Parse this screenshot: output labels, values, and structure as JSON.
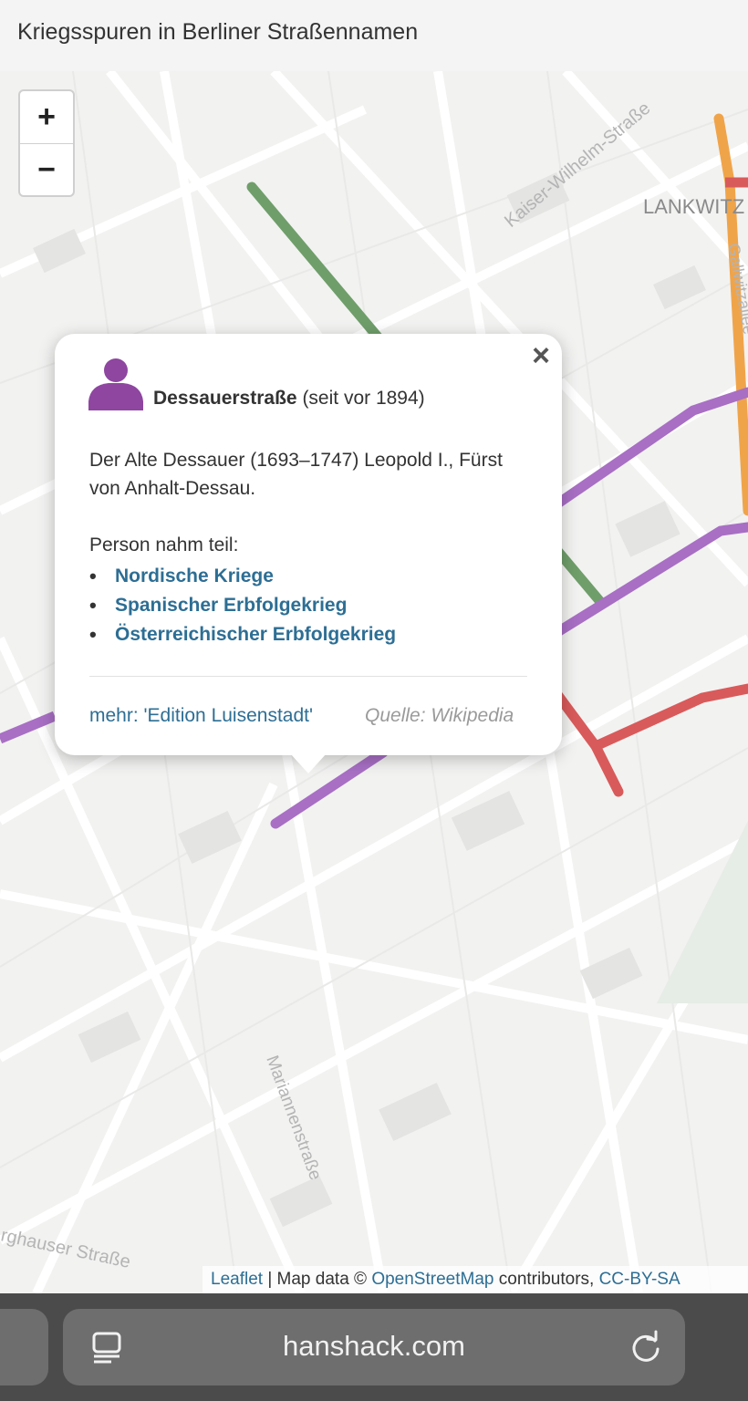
{
  "title": "Kriegsspuren in Berliner Straßennamen",
  "colors": {
    "link": "#2d6e94",
    "person_icon": "#8e46a0",
    "line_purple": "#a86fc4",
    "line_green": "#6f9e6a",
    "line_red": "#d95a5a",
    "line_orange": "#f0a44a"
  },
  "map": {
    "street_labels": [
      "Kaiser-Wilhelm-Straße",
      "LANKWITZ",
      "Gallwitzallee",
      "Mariannenstraße",
      "rghauser Straße"
    ],
    "zoom_in": "+",
    "zoom_out": "−"
  },
  "popup": {
    "icon": "person-icon",
    "close": "×",
    "street_name": "Dessauerstraße",
    "since": "(seit vor 1894)",
    "description": "Der Alte Dessauer (1693–1747) Leopold I., Fürst von Anhalt-Dessau.",
    "participated_label": "Person nahm teil:",
    "wars": [
      "Nordische Kriege",
      "Spanischer Erbfolgekrieg",
      "Österreichischer Erbfolgekrieg"
    ],
    "more_link": "mehr: 'Edition Luisenstadt'",
    "source": "Quelle: Wikipedia"
  },
  "attribution": {
    "leaflet": "Leaflet",
    "sep": " | Map data © ",
    "osm": "OpenStreetMap",
    "contrib": " contributors, ",
    "license": "CC-BY-SA"
  },
  "browser": {
    "url": "hanshack.com",
    "tabs_icon": "tabs-icon",
    "reload_icon": "reload-icon"
  }
}
